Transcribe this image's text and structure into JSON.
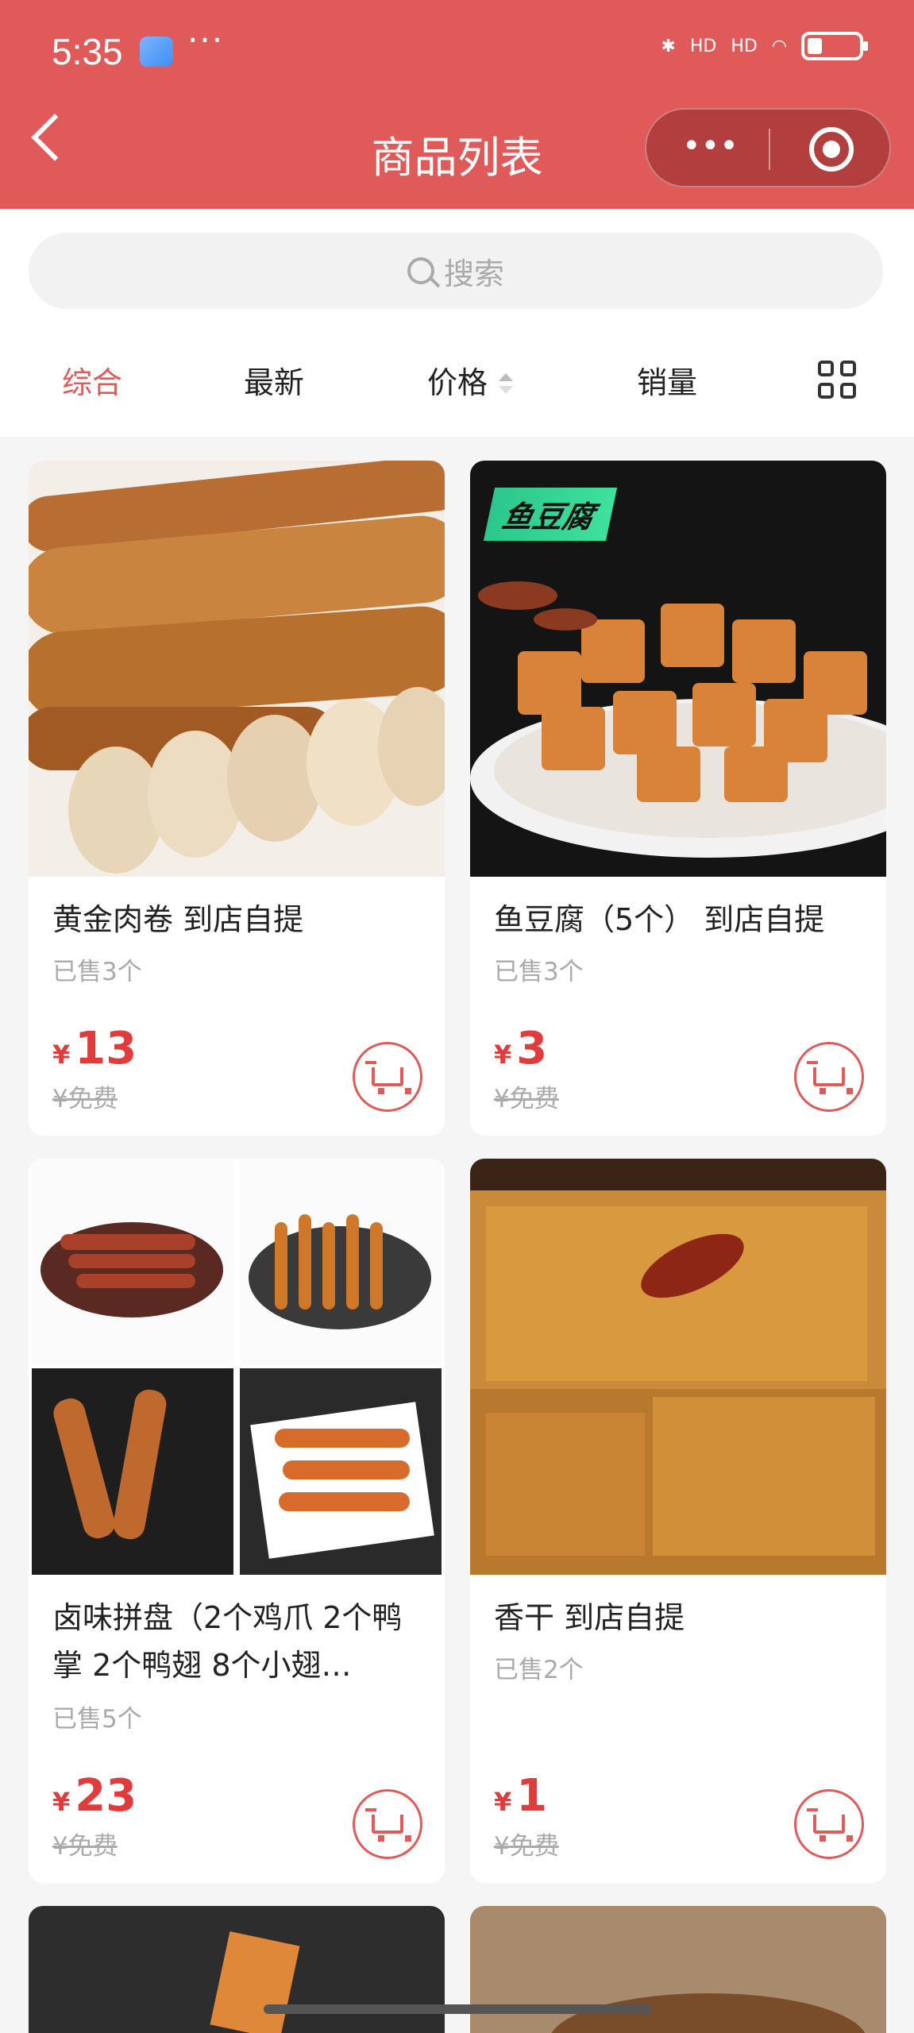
{
  "status": {
    "time": "5:35",
    "dots": "···",
    "signal1": "HD",
    "signal2": "HD"
  },
  "header": {
    "title": "商品列表",
    "more": "•••"
  },
  "search": {
    "placeholder": "搜索"
  },
  "sort": {
    "items": [
      "综合",
      "最新",
      "价格",
      "销量"
    ],
    "active": "综合"
  },
  "colors": {
    "accent": "#e05a5a",
    "price": "#e03c3c"
  },
  "products": [
    {
      "name": "黄金肉卷 到店自提",
      "sold": "已售3个",
      "currency": "¥",
      "price": "13",
      "original": "¥免费"
    },
    {
      "name": "鱼豆腐（5个） 到店自提",
      "sold": "已售3个",
      "currency": "¥",
      "price": "3",
      "original": "¥免费",
      "badge": "鱼豆腐"
    },
    {
      "name": "卤味拼盘（2个鸡爪 2个鸭掌 2个鸭翅 8个小翅…",
      "sold": "已售5个",
      "currency": "¥",
      "price": "23",
      "original": "¥免费"
    },
    {
      "name": "香干 到店自提",
      "sold": "已售2个",
      "currency": "¥",
      "price": "1",
      "original": "¥免费"
    }
  ]
}
